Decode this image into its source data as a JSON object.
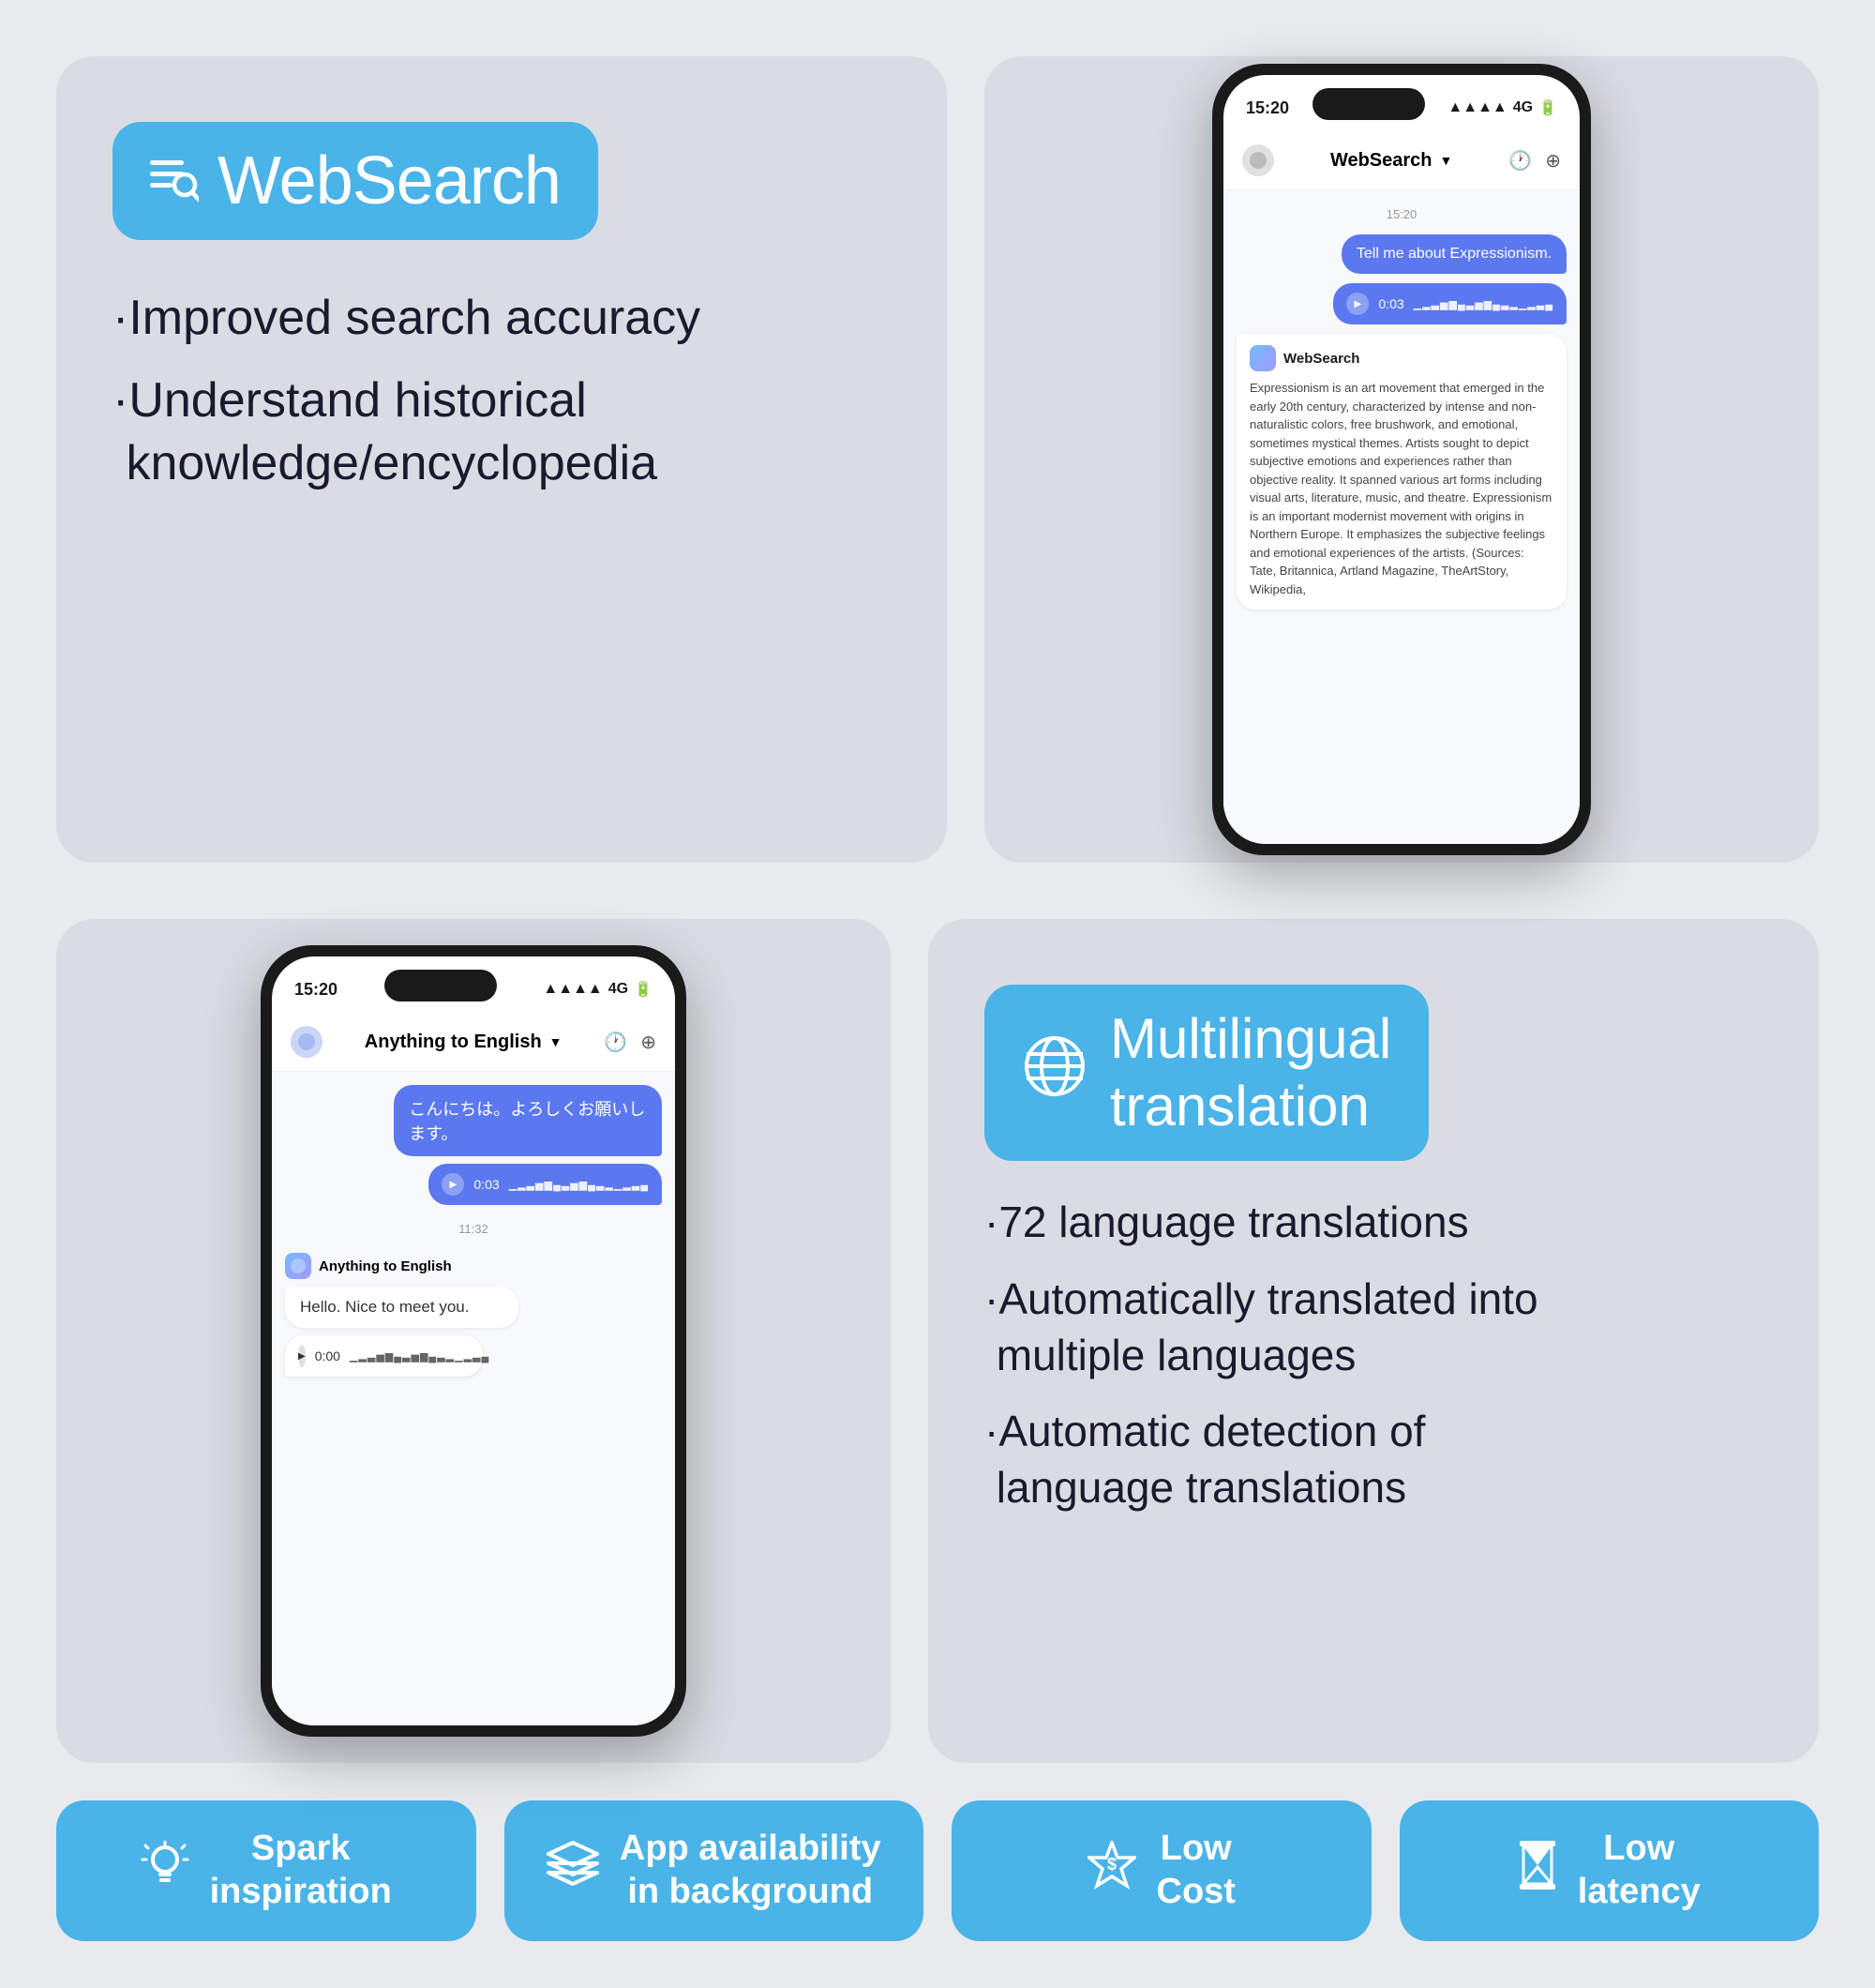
{
  "background": "#e8eaed",
  "websearch": {
    "badge_label": "WebSearch",
    "feature1": "·Improved search accuracy",
    "feature2": "·Understand historical\n knowledge/encyclopedia"
  },
  "phone_top": {
    "status_time": "15:20",
    "status_signal": "4G",
    "chat_title": "WebSearch",
    "chat_time": "15:20",
    "user_msg": "Tell me about Expressionism.",
    "voice_time": "0:03",
    "voice_waveform": "||||||||||||||||",
    "ai_name": "WebSearch",
    "ai_text": "Expressionism is an art movement that emerged in the early 20th century, characterized by intense and non-naturalistic colors, free brushwork, and emotional, sometimes mystical themes. Artists sought to depict subjective emotions and experiences rather than objective reality. It spanned various art forms including visual arts, literature, music, and theatre. Expressionism is an important modernist movement with origins in Northern Europe. It emphasizes the subjective feelings and emotional experiences of the artists. (Sources: Tate, Britannica, Artland Magazine, TheArtStory, Wikipedia,"
  },
  "phone_bottom": {
    "status_time": "15:20",
    "status_signal": "4G",
    "chat_title": "Anything to English",
    "time_label": "11:32",
    "user_msg_jp": "こんにちは。よろしくお願いします。",
    "voice_time_jp": "0:03",
    "voice_waveform_jp": "||||||||||||||||",
    "ai_name": "Anything to English",
    "ai_text": "Hello. Nice to meet you.",
    "voice_time_ai": "0:00",
    "voice_waveform_ai": "||||||||||||||||"
  },
  "multilingual": {
    "badge_label": "Multilingual\ntranslation",
    "feature1": "·72 language translations",
    "feature2": "·Automatically translated into\n multiple languages",
    "feature3": "·Automatic detection of\n language translations"
  },
  "footer": {
    "card1_icon": "💡",
    "card1_label": "Spark\ninspiration",
    "card2_icon": "⊞",
    "card2_label": "App availability\nin background",
    "card3_icon": "💲",
    "card3_label": "Low\nCost",
    "card4_icon": "⏳",
    "card4_label": "Low\nlatency"
  }
}
